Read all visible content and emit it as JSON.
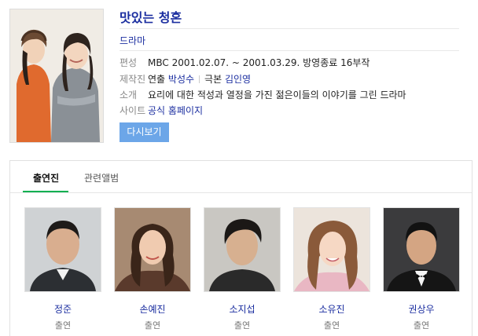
{
  "drama": {
    "title": "맛있는 청혼",
    "genre": "드라마"
  },
  "info": {
    "broadcast": {
      "label": "편성",
      "value": "MBC 2001.02.07. ~ 2001.03.29.  방영종료 16부작"
    },
    "staff": {
      "label": "제작진",
      "director_prefix": "연출",
      "director": "박성수",
      "writer_prefix": "극본",
      "writer": "김인영"
    },
    "intro": {
      "label": "소개",
      "value": "요리에 대한 적성과 열정을 가진 젊은이들의 이야기를 그린 드라마"
    },
    "site": {
      "label": "사이트",
      "value": "공식 홈페이지"
    }
  },
  "watch_button": "다시보기",
  "tabs": [
    {
      "label": "출연진",
      "active": true
    },
    {
      "label": "관련앨범",
      "active": false
    }
  ],
  "cast": [
    {
      "name": "정준",
      "role": "출연"
    },
    {
      "name": "손예진",
      "role": "출연"
    },
    {
      "name": "소지섭",
      "role": "출연"
    },
    {
      "name": "소유진",
      "role": "출연"
    },
    {
      "name": "권상우",
      "role": "출연"
    }
  ],
  "colors": {
    "link": "#1c2fa0",
    "button": "#6ca6e8",
    "tab_accent": "#00b050"
  }
}
